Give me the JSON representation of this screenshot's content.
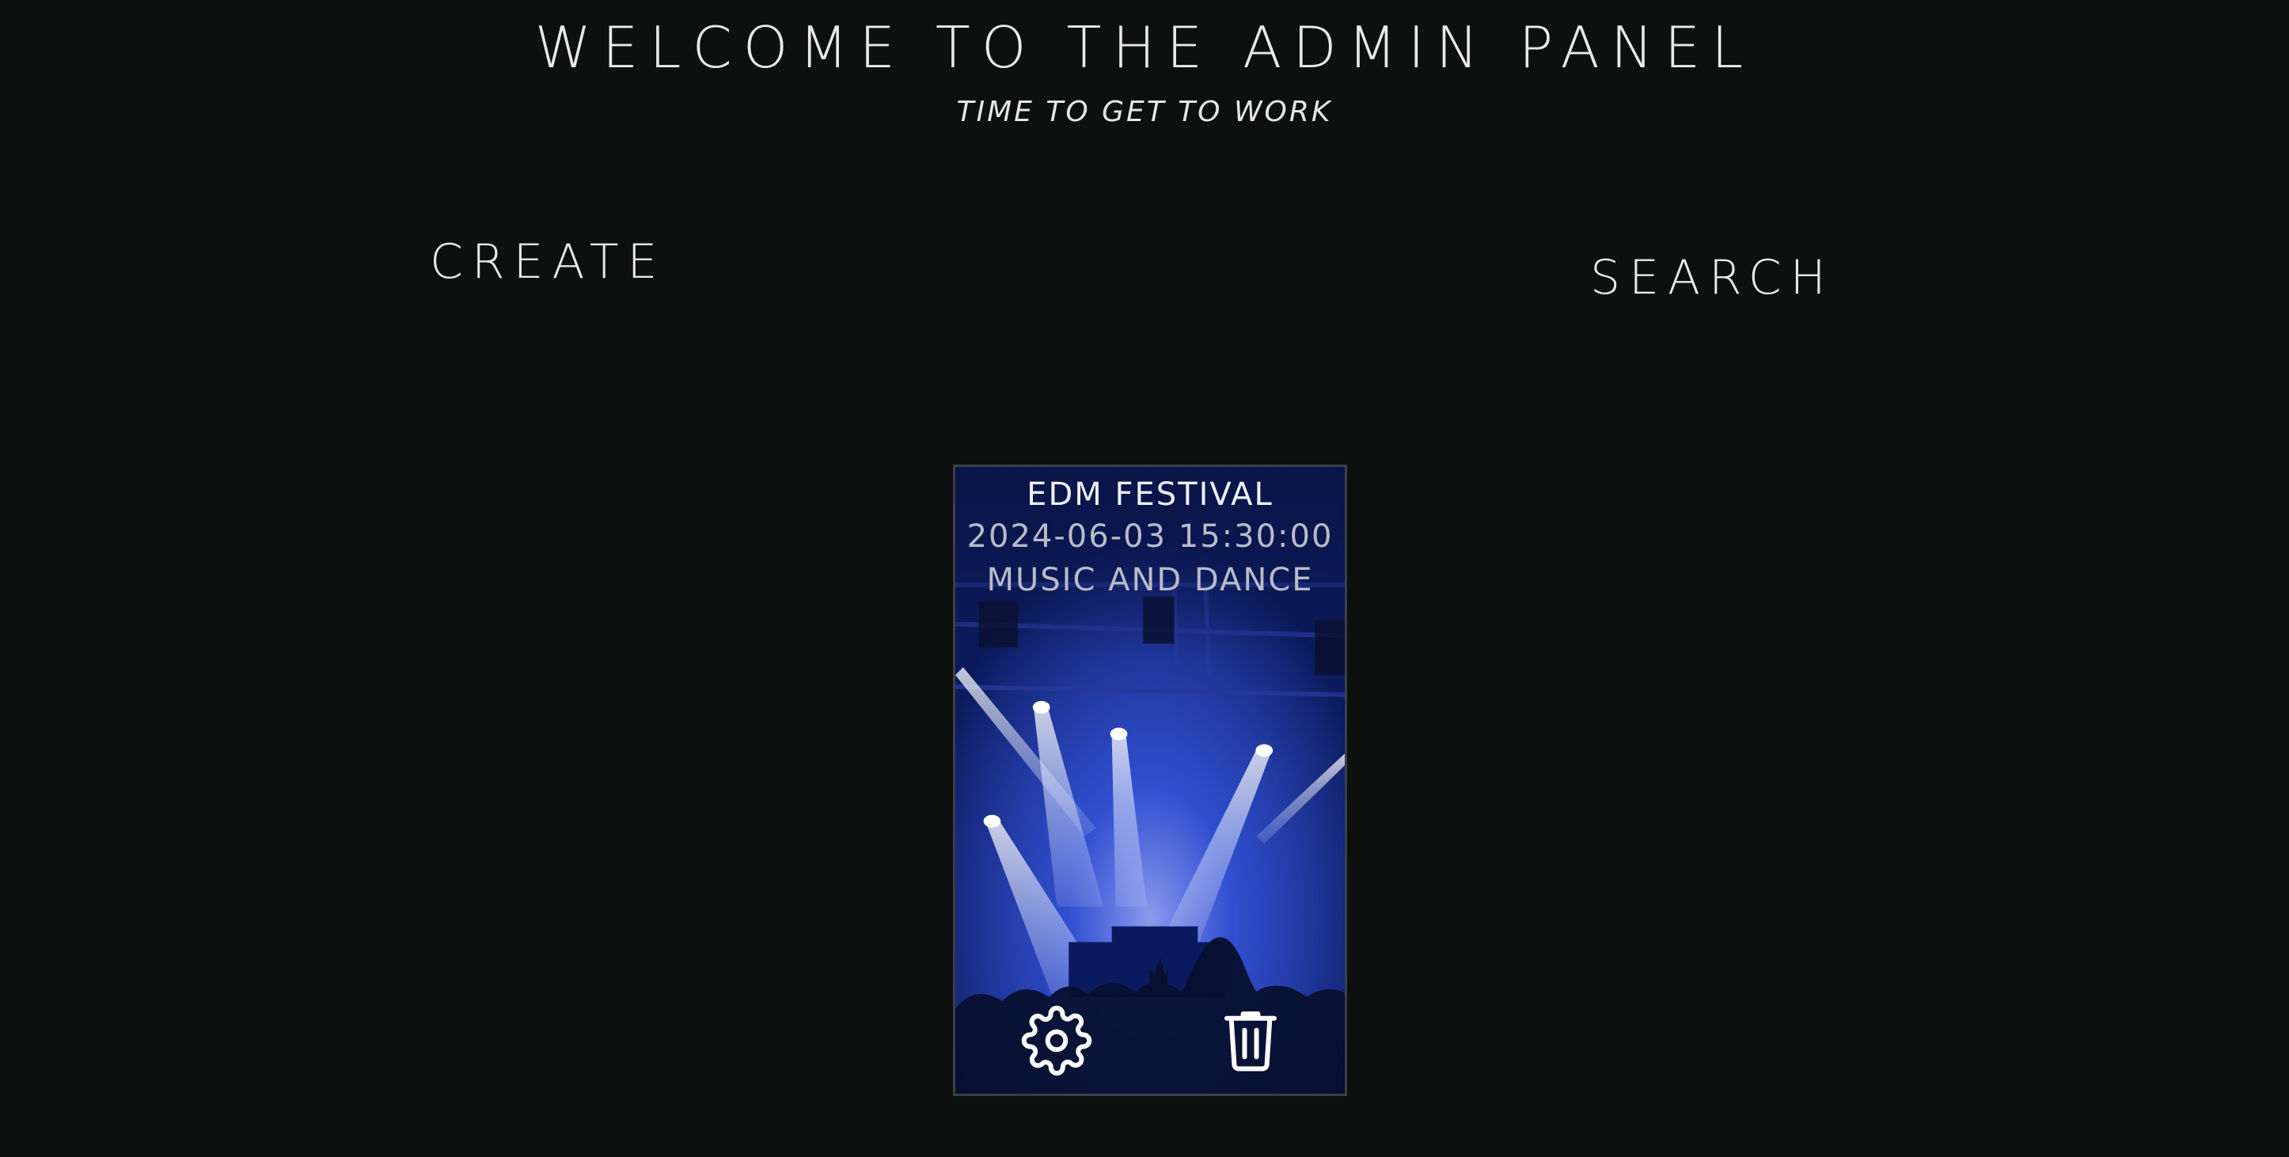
{
  "header": {
    "title": "WELCOME TO THE ADMIN PANEL",
    "subtitle": "TIME TO GET TO WORK"
  },
  "nav": {
    "create_label": "CREATE",
    "search_label": "SEARCH"
  },
  "events": [
    {
      "title": "EDM FESTIVAL",
      "datetime": "2024-06-03 15:30:00",
      "category": "MUSIC AND DANCE",
      "actions": {
        "edit_icon": "gear-icon",
        "delete_icon": "trash-icon"
      }
    }
  ],
  "colors": {
    "background": "#0e100f",
    "text": "#e9e9e9",
    "card_tint": "#1b3cc8"
  }
}
